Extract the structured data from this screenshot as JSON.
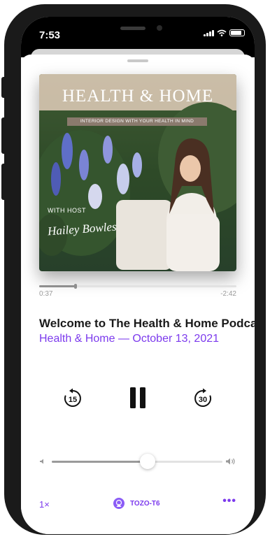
{
  "status_bar": {
    "time": "7:53"
  },
  "artwork": {
    "title": "HEALTH & HOME",
    "subtitle": "INTERIOR DESIGN WITH YOUR HEALTH IN MIND",
    "host_label": "WITH HOST",
    "host_name": "Hailey Bowles"
  },
  "playback": {
    "elapsed": "0:37",
    "remaining": "-2:42",
    "progress_fraction": 0.185
  },
  "episode": {
    "title": "Welcome to The Health & Home Podcast",
    "subtitle": "Health & Home — October 13, 2021"
  },
  "controls": {
    "skip_back_seconds": "15",
    "skip_forward_seconds": "30"
  },
  "volume": {
    "level_fraction": 0.56
  },
  "footer": {
    "speed": "1×",
    "route_device": "TOZO-T6",
    "more": "•••"
  },
  "colors": {
    "accent": "#7c3aed",
    "text": "#1a1a1a",
    "muted": "#9a9a9a"
  }
}
